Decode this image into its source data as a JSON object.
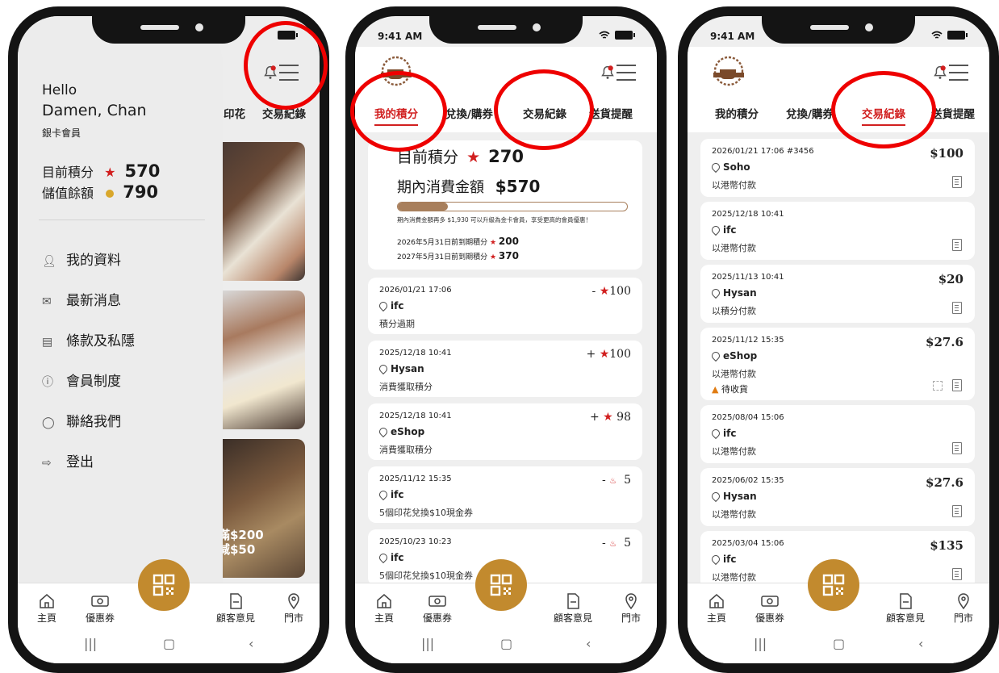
{
  "status": {
    "time": "9:41 AM"
  },
  "nav": {
    "home": "主頁",
    "coupons": "優惠券",
    "feedback": "顧客意見",
    "stores": "門市"
  },
  "tabs": {
    "points": "我的積分",
    "redeem": "兌換/購券",
    "stamps": "印花",
    "transactions": "交易紀錄",
    "delivery": "送貨提醒"
  },
  "drawer": {
    "hello": "Hello",
    "name": "Damen, Chan",
    "tier": "銀卡會員",
    "points_label": "目前積分",
    "points_value": "570",
    "balance_label": "儲值餘額",
    "balance_value": "790",
    "menu": [
      "我的資料",
      "最新消息",
      "條款及私隱",
      "會員制度",
      "聯絡我們",
      "登出"
    ],
    "promo_line1": "滿$200",
    "promo_line2": "減$50"
  },
  "points_screen": {
    "current_label": "目前積分",
    "current_value": "270",
    "spend_label": "期內消費金額",
    "spend_value": "$570",
    "progress": 0.22,
    "upgrade_note": "期內消費金額再多 $1,930 可以升級為金卡會員，享受更高的會員優惠！",
    "expiry": [
      {
        "label": "2026年5月31日前到期積分",
        "value": "200"
      },
      {
        "label": "2027年5月31日前到期積分",
        "value": "370"
      }
    ],
    "rows": [
      {
        "date": "2026/01/21 17:06",
        "place": "ifc",
        "desc": "積分過期",
        "sign": "-",
        "value": "100",
        "kind": "star"
      },
      {
        "date": "2025/12/18 10:41",
        "place": "Hysan",
        "desc": "消費獲取積分",
        "sign": "+",
        "value": "100",
        "kind": "star"
      },
      {
        "date": "2025/12/18 10:41",
        "place": "eShop",
        "desc": "消費獲取積分",
        "sign": "+",
        "value": "98",
        "kind": "star"
      },
      {
        "date": "2025/11/12 15:35",
        "place": "ifc",
        "desc": "5個印花兌換$10現金券",
        "sign": "-",
        "value": "5",
        "kind": "stamp"
      },
      {
        "date": "2025/10/23 10:23",
        "place": "ifc",
        "desc": "5個印花兌換$10現金券",
        "sign": "-",
        "value": "5",
        "kind": "stamp"
      }
    ]
  },
  "transactions": [
    {
      "date": "2026/01/21 17:06 #3456",
      "place": "Soho",
      "pay": "以港幣付款",
      "amount": "$100"
    },
    {
      "date": "2025/12/18 10:41",
      "place": "ifc",
      "pay": "以港幣付款",
      "amount": ""
    },
    {
      "date": "2025/11/13 10:41",
      "place": "Hysan",
      "pay": "以積分付款",
      "amount": "$20"
    },
    {
      "date": "2025/11/12 15:35",
      "place": "eShop",
      "pay": "以港幣付款",
      "amount": "$27.6",
      "status": "待收貨"
    },
    {
      "date": "2025/08/04 15:06",
      "place": "ifc",
      "pay": "以港幣付款",
      "amount": ""
    },
    {
      "date": "2025/06/02 15:35",
      "place": "Hysan",
      "pay": "以港幣付款",
      "amount": "$27.6"
    },
    {
      "date": "2025/03/04 15:06",
      "place": "ifc",
      "pay": "以港幣付款",
      "amount": "$135"
    }
  ],
  "colors": {
    "accent": "#d11f1f",
    "gold": "#c28a2e",
    "highlight_ring": "#ee0000"
  },
  "icons": [
    "bell-icon",
    "menu-icon",
    "coffee-shop-logo",
    "qr-code-icon",
    "home-icon",
    "coupon-icon",
    "document-icon",
    "location-icon",
    "receipt-icon"
  ]
}
